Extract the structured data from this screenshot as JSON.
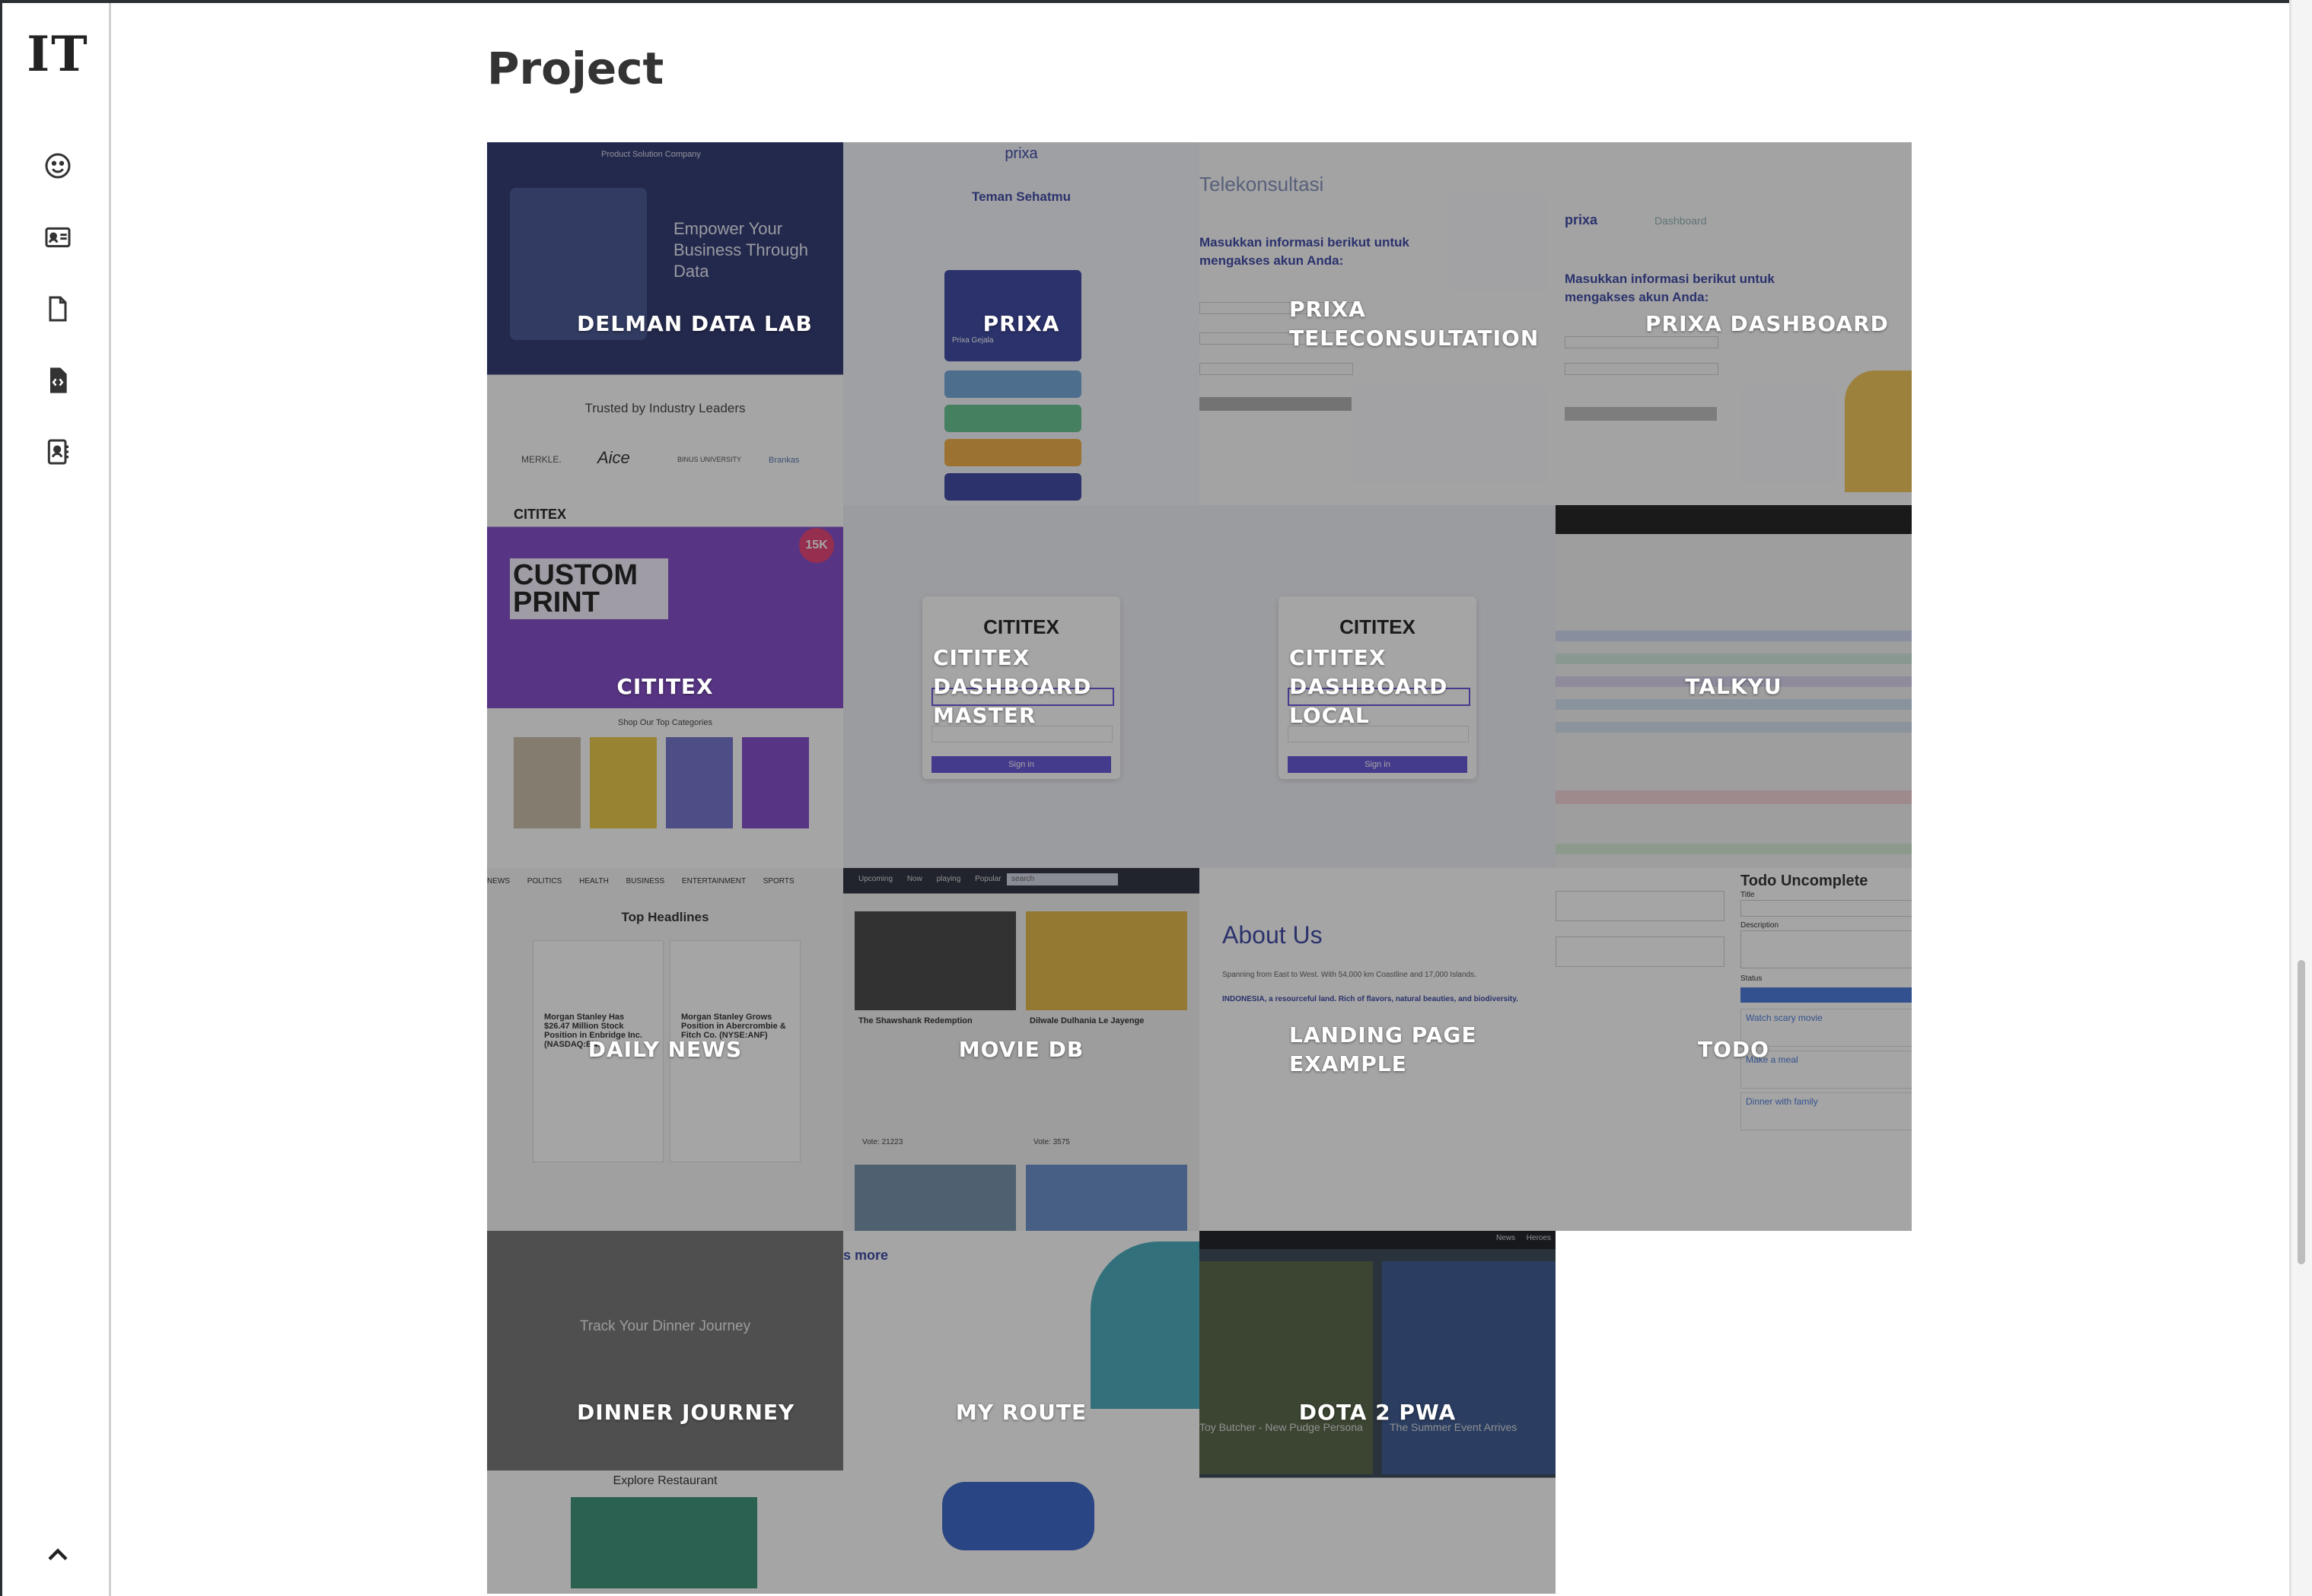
{
  "app": {
    "logo": "IT"
  },
  "sidebar": {
    "items": [
      {
        "name": "about",
        "icon": "smiley-icon"
      },
      {
        "name": "profile",
        "icon": "id-card-icon"
      },
      {
        "name": "resume",
        "icon": "document-icon"
      },
      {
        "name": "projects",
        "icon": "code-file-icon"
      },
      {
        "name": "contact",
        "icon": "contact-card-icon"
      }
    ],
    "scroll_top_icon": "chevron-up-icon"
  },
  "page": {
    "title": "Project"
  },
  "projects": [
    {
      "label": "DELMAN DATA LAB"
    },
    {
      "label": "PRIXA"
    },
    {
      "label": "PRIXA TELECONSULTATION"
    },
    {
      "label": "PRIXA DASHBOARD"
    },
    {
      "label": "CITITEX"
    },
    {
      "label": "CITITEX DASHBOARD MASTER"
    },
    {
      "label": "CITITEX DASHBOARD LOCAL"
    },
    {
      "label": "TALKYU"
    },
    {
      "label": "DAILY NEWS"
    },
    {
      "label": "MOVIE DB"
    },
    {
      "label": "LANDING PAGE EXAMPLE"
    },
    {
      "label": "TODO"
    },
    {
      "label": "DINNER JOURNEY"
    },
    {
      "label": "MY ROUTE"
    },
    {
      "label": "DOTA 2 PWA"
    }
  ],
  "thumbnail_text": {
    "delman": {
      "nav": "Product   Solution   Company",
      "headline": "Empower Your Business Through Data",
      "trusted": "Trusted by Industry Leaders",
      "logos": [
        "MERKLE.",
        "Aice",
        "BINUS UNIVERSITY",
        "Brankas"
      ]
    },
    "prixa": {
      "brand": "prixa",
      "heading": "Teman Sehatmu",
      "card": "Prixa Gejala"
    },
    "teleco": {
      "title": "Telekonsultasi",
      "heading": "Masukkan informasi berikut untuk mengakses akun Anda:"
    },
    "dash": {
      "brand": "prixa",
      "section": "Dashboard",
      "heading": "Masukkan informasi berikut untuk mengakses akun Anda:"
    },
    "cititex": {
      "brand": "CITITEX",
      "banner": "CUSTOM PRINT",
      "sub": "Shop Our Top Categories",
      "badge": "15K"
    },
    "ctxdash": {
      "brand": "CITITEX",
      "button": "Sign in"
    },
    "news": {
      "tabs": [
        "NEWS",
        "POLITICS",
        "HEALTH",
        "BUSINESS",
        "ENTERTAINMENT",
        "SPORTS"
      ],
      "heading": "Top Headlines",
      "articles": [
        "Morgan Stanley Has $26.47 Million Stock Position in Enbridge Inc. (NASDAQ:EN...",
        "Morgan Stanley Grows Position in Abercrombie & Fitch Co. (NYSE:ANF)"
      ]
    },
    "movie": {
      "tabs": [
        "Upcoming",
        "Now playing",
        "Popular"
      ],
      "search": "search",
      "films": [
        "The Shawshank Redemption",
        "Dilwale Dulhania Le Jayenge"
      ],
      "votes": [
        "Vote: 21223",
        "Vote: 3575"
      ]
    },
    "landing": {
      "heading": "About Us",
      "line1": "Spanning from East to West. With 54,000 km Coastline and 17,000 Islands.",
      "line2": "INDONESIA, a resourceful land. Rich of flavors, natural beauties, and biodiversity."
    },
    "todo": {
      "heading": "Todo Uncomplete",
      "fields": [
        "Title",
        "Description",
        "Status"
      ],
      "items": [
        "Watch scary movie",
        "Make a meal",
        "Dinner with family"
      ]
    },
    "dinner": {
      "headline": "Track Your Dinner Journey",
      "sub": "Explore Restaurant"
    },
    "route": {
      "text": "s more"
    },
    "dota": {
      "nav": [
        "News",
        "Heroes"
      ],
      "cards": [
        "Toy Butcher - New Pudge Persona",
        "The Summer Event Arrives"
      ]
    }
  },
  "colors": {
    "overlay": "rgba(40,40,40,0.42)",
    "delman_navy": "#1f2a68",
    "prixa_blue": "#2d3a9e",
    "cititex_purple": "#7b3fc7",
    "todo_blue": "#3b6fd8"
  }
}
